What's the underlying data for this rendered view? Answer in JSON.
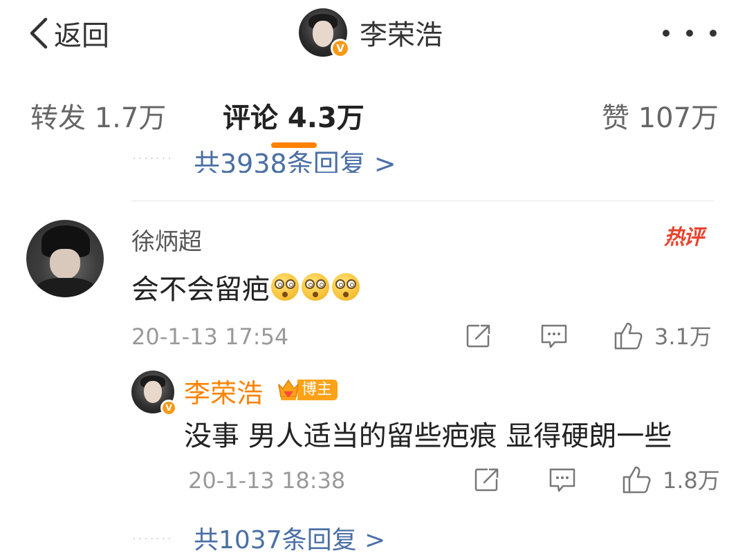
{
  "header": {
    "back_label": "返回",
    "author_name": "李荣浩",
    "verified_badge": "V"
  },
  "tabs": [
    {
      "label": "转发 1.7万"
    },
    {
      "label": "评论 4.3万"
    },
    {
      "label": "赞 107万"
    }
  ],
  "colors": {
    "accent": "#ff8200",
    "link": "#4a6fa5",
    "hot": "#e8432e"
  },
  "partial_reply_link": "共3938条回复 >",
  "comment": {
    "user": "徐炳超",
    "hot_badge": "热评",
    "text": "会不会留疤",
    "emoji_count": 3,
    "time": "20-1-13 17:54",
    "like_count": "3.1万",
    "reply": {
      "user": "李荣浩",
      "badge_label": "博主",
      "text": "没事 男人适当的留些疤痕 显得硬朗一些",
      "time": "20-1-13 18:38",
      "like_count": "1.8万"
    },
    "more_replies": "共1037条回复 >"
  }
}
